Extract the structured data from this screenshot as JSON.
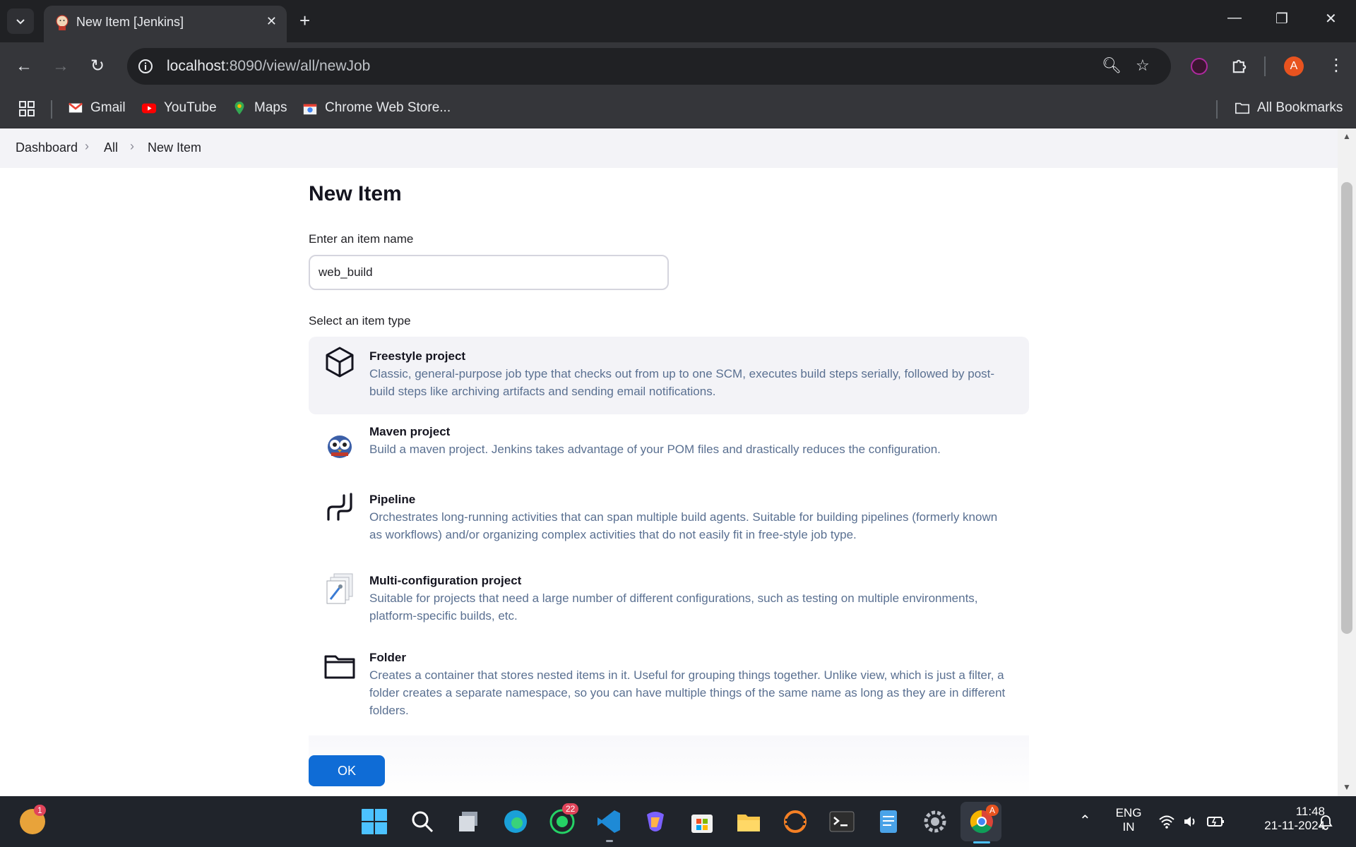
{
  "browser": {
    "tab_title": "New Item [Jenkins]",
    "url_host": "localhost",
    "url_rest": ":8090/view/all/newJob",
    "bookmarks": [
      "Gmail",
      "YouTube",
      "Maps",
      "Chrome Web Store..."
    ],
    "all_bookmarks": "All Bookmarks",
    "profile_initial": "A"
  },
  "breadcrumb": [
    "Dashboard",
    "All",
    "New Item"
  ],
  "main": {
    "title": "New Item",
    "name_label": "Enter an item name",
    "name_value": "web_build",
    "type_label": "Select an item type",
    "ok_label": "OK",
    "items": [
      {
        "title": "Freestyle project",
        "desc": "Classic, general-purpose job type that checks out from up to one SCM, executes build steps serially, followed by post-build steps like archiving artifacts and sending email notifications.",
        "icon": "cube-icon",
        "selected": true
      },
      {
        "title": "Maven project",
        "desc": "Build a maven project. Jenkins takes advantage of your POM files and drastically reduces the configuration.",
        "icon": "maven-owl-icon"
      },
      {
        "title": "Pipeline",
        "desc": "Orchestrates long-running activities that can span multiple build agents. Suitable for building pipelines (formerly known as workflows) and/or organizing complex activities that do not easily fit in free-style job type.",
        "icon": "pipeline-icon"
      },
      {
        "title": "Multi-configuration project",
        "desc": "Suitable for projects that need a large number of different configurations, such as testing on multiple environments, platform-specific builds, etc.",
        "icon": "multi-config-icon"
      },
      {
        "title": "Folder",
        "desc": "Creates a container that stores nested items in it. Useful for grouping things together. Unlike view, which is just a filter, a folder creates a separate namespace, so you can have multiple things of the same name as long as they are in different folders.",
        "icon": "folder-icon"
      }
    ]
  },
  "taskbar": {
    "lang_top": "ENG",
    "lang_bottom": "IN",
    "time": "11:48",
    "date": "21-11-2024",
    "whatsapp_badge": "22",
    "weather_badge": "1",
    "chrome_badge": "A"
  },
  "colors": {
    "accent": "#0f6cd6",
    "desc_text": "#5a7091",
    "selected_bg": "#f3f3f7"
  }
}
